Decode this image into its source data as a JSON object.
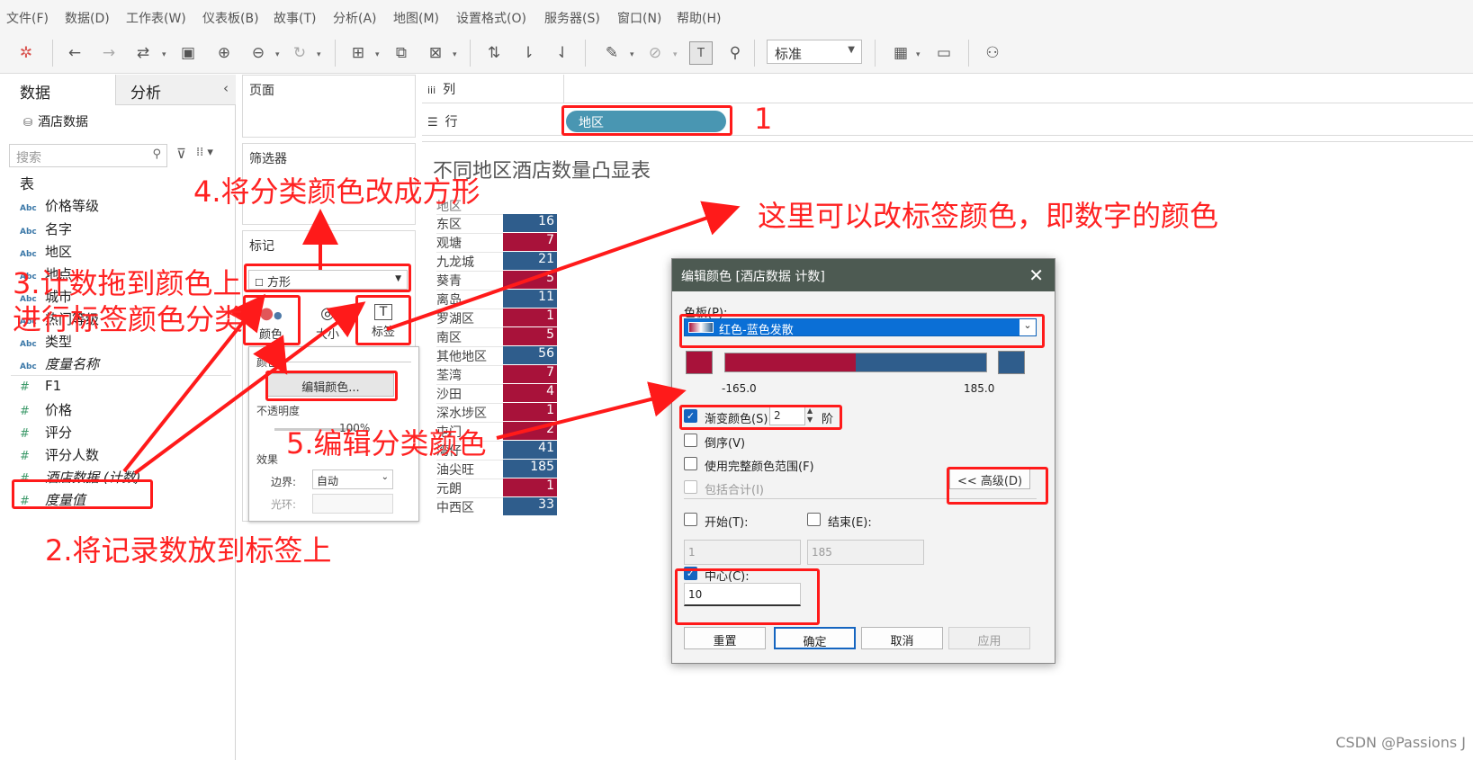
{
  "menu": [
    "文件(F)",
    "数据(D)",
    "工作表(W)",
    "仪表板(B)",
    "故事(T)",
    "分析(A)",
    "地图(M)",
    "设置格式(O)",
    "服务器(S)",
    "窗口(N)",
    "帮助(H)"
  ],
  "toolbar": {
    "zoom_label": "标准"
  },
  "datapane": {
    "tab_data": "数据",
    "tab_analysis": "分析",
    "datasource": "酒店数据",
    "search_placeholder": "搜索",
    "section_table": "表",
    "dimensions": [
      "价格等级",
      "名字",
      "地区",
      "地点",
      "城市",
      "热门等级",
      "类型",
      "度量名称"
    ],
    "dimension_type": "Abc",
    "measures": [
      "F1",
      "价格",
      "评分",
      "评分人数",
      "酒店数据 (计数)",
      "度量值"
    ],
    "measure_type": "#"
  },
  "shelves": {
    "pages": "页面",
    "filters": "筛选器",
    "marks": "标记",
    "mark_type": "方形",
    "mark_buttons": [
      "颜色",
      "大小",
      "标签"
    ],
    "color_popup": {
      "section_color": "颜色",
      "edit_color": "编辑颜色...",
      "opacity": "不透明度",
      "opacity_value": "100%",
      "effects": "效果",
      "border_label": "边界:",
      "border_value": "自动",
      "halo_label": "光环:"
    },
    "columns": "列",
    "rows": "行",
    "row_pill": "地区"
  },
  "view": {
    "title": "不同地区酒店数量凸显表",
    "column_header": "地区",
    "rows": [
      {
        "label": "东区",
        "value": "16",
        "color": "#2f5d8c"
      },
      {
        "label": "观塘",
        "value": "7",
        "color": "#a8123a"
      },
      {
        "label": "九龙城",
        "value": "21",
        "color": "#2f5d8c"
      },
      {
        "label": "葵青",
        "value": "5",
        "color": "#a8123a"
      },
      {
        "label": "离岛",
        "value": "11",
        "color": "#2f5d8c"
      },
      {
        "label": "罗湖区",
        "value": "1",
        "color": "#a8123a"
      },
      {
        "label": "南区",
        "value": "5",
        "color": "#a8123a"
      },
      {
        "label": "其他地区",
        "value": "56",
        "color": "#2f5d8c"
      },
      {
        "label": "荃湾",
        "value": "7",
        "color": "#a8123a"
      },
      {
        "label": "沙田",
        "value": "4",
        "color": "#a8123a"
      },
      {
        "label": "深水埗区",
        "value": "1",
        "color": "#a8123a"
      },
      {
        "label": "屯门",
        "value": "2",
        "color": "#a8123a"
      },
      {
        "label": "湾仔",
        "value": "41",
        "color": "#2f5d8c"
      },
      {
        "label": "油尖旺",
        "value": "185",
        "color": "#2f5d8c"
      },
      {
        "label": "元朗",
        "value": "1",
        "color": "#a8123a"
      },
      {
        "label": "中西区",
        "value": "33",
        "color": "#2f5d8c"
      }
    ]
  },
  "dialog": {
    "title": "编辑颜色 [酒店数据 计数]",
    "palette_label": "色板(P):",
    "palette_value": "红色-蓝色发散",
    "range_min": "-165.0",
    "range_max": "185.0",
    "stepped_label": "渐变颜色(S)",
    "stepped_value": "2",
    "stepped_unit": "阶",
    "reversed_label": "倒序(V)",
    "full_range_label": "使用完整颜色范围(F)",
    "include_totals_label": "包括合计(I)",
    "advanced_btn": "<< 高级(D)",
    "start_label": "开始(T):",
    "start_value": "1",
    "end_label": "结束(E):",
    "end_value": "185",
    "center_label": "中心(C):",
    "center_value": "10",
    "buttons": [
      "重置",
      "确定",
      "取消",
      "应用"
    ],
    "low_color": "#a8123a",
    "high_color": "#2f5d8c"
  },
  "annotations": {
    "a1": "1",
    "a2": "2.将记录数放到标签上",
    "a3_line1": "3.计数拖到颜色上",
    "a3_line2": "进行标签颜色分类",
    "a4": "4.将分类颜色改成方形",
    "a5": "5.编辑分类颜色",
    "a6": "这里可以改标签颜色，即数字的颜色",
    "accent": "#ff1a1a"
  },
  "watermark": "CSDN @Passions J"
}
